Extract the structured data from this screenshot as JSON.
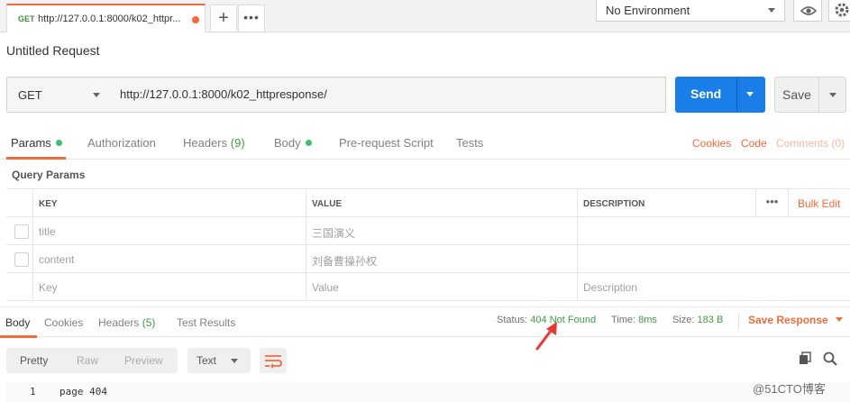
{
  "tab": {
    "method": "GET",
    "url": "http://127.0.0.1:8000/k02_httpr..."
  },
  "environment": "No Environment",
  "request_title": "Untitled Request",
  "request": {
    "method": "GET",
    "url": "http://127.0.0.1:8000/k02_httpresponse/"
  },
  "buttons": {
    "send": "Send",
    "save": "Save"
  },
  "req_tabs": {
    "params": "Params",
    "authorization": "Authorization",
    "headers": "Headers",
    "headers_count": "(9)",
    "body": "Body",
    "prerequest": "Pre-request Script",
    "tests": "Tests",
    "cookies": "Cookies",
    "code": "Code",
    "comments": "Comments (0)"
  },
  "query_params_title": "Query Params",
  "params_table": {
    "headers": {
      "key": "KEY",
      "value": "VALUE",
      "description": "DESCRIPTION",
      "bulk_edit": "Bulk Edit"
    },
    "rows": [
      {
        "key": "title",
        "value": "三国演义",
        "description": ""
      },
      {
        "key": "content",
        "value": "刘备曹操孙权",
        "description": ""
      }
    ],
    "placeholder": {
      "key": "Key",
      "value": "Value",
      "description": "Description"
    }
  },
  "resp_tabs": {
    "body": "Body",
    "cookies": "Cookies",
    "headers": "Headers",
    "headers_count": "(5)",
    "test_results": "Test Results"
  },
  "response_meta": {
    "status_label": "Status:",
    "status_value": "404 Not Found",
    "time_label": "Time:",
    "time_value": "8ms",
    "size_label": "Size:",
    "size_value": "183 B",
    "save_response": "Save Response"
  },
  "viewer": {
    "pretty": "Pretty",
    "raw": "Raw",
    "preview": "Preview",
    "format": "Text"
  },
  "response_body": [
    {
      "line": "1",
      "text": "page 404"
    }
  ],
  "watermark": "@51CTO博客",
  "colors": {
    "accent": "#f26b3a",
    "primary": "#1a7ee8",
    "success": "#3f9b3f"
  }
}
